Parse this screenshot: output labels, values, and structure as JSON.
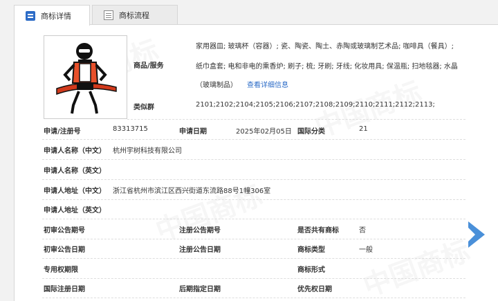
{
  "tabs": [
    {
      "label": "商标详情",
      "active": true,
      "icon": "document-list-icon"
    },
    {
      "label": "商标流程",
      "active": false,
      "icon": "flow-chart-icon"
    }
  ],
  "watermark_text": "中国商标",
  "goods": {
    "label": "商品/服务",
    "lines": [
      "家用器皿; 玻璃杯（容器）; 瓷、陶瓷、陶土、赤陶或玻璃制艺术品; 咖啡具（餐具）;",
      "纸巾盒套; 电和非电的熏香炉; 刷子; 梳; 牙刷; 牙线; 化妆用具; 保温瓶; 扫地毯器; 水晶",
      "（玻璃制品）"
    ],
    "detail_link": "查看详细信息"
  },
  "similar_group": {
    "label": "类似群",
    "value": "2101;2102;2104;2105;2106;2107;2108;2109;2110;2111;2112;2113;"
  },
  "fields": {
    "reg_no_label": "申请/注册号",
    "reg_no": "83313715",
    "app_date_label": "申请日期",
    "app_date": "2025年02月05日",
    "intl_class_label": "国际分类",
    "intl_class": "21",
    "applicant_cn_label": "申请人名称（中文）",
    "applicant_cn": "杭州宇树科技有限公司",
    "applicant_en_label": "申请人名称（英文）",
    "applicant_en": "",
    "address_cn_label": "申请人地址（中文）",
    "address_cn": "浙江省杭州市滨江区西兴街道东流路88号1幢306室",
    "address_en_label": "申请人地址（英文）",
    "address_en": "",
    "prelim_pub_no_label": "初审公告期号",
    "prelim_pub_no": "",
    "reg_pub_no_label": "注册公告期号",
    "reg_pub_no": "",
    "shared_label": "是否共有商标",
    "shared": "否",
    "prelim_pub_date_label": "初审公告日期",
    "prelim_pub_date": "",
    "reg_pub_date_label": "注册公告日期",
    "reg_pub_date": "",
    "mark_type_label": "商标类型",
    "mark_type": "一般",
    "exclusive_period_label": "专用权期限",
    "exclusive_period": "",
    "mark_form_label": "商标形式",
    "mark_form": "",
    "intl_reg_date_label": "国际注册日期",
    "intl_reg_date": "",
    "later_designation_label": "后期指定日期",
    "later_designation": "",
    "priority_date_label": "优先权日期",
    "priority_date": ""
  },
  "colors": {
    "accent": "#2d6cc7",
    "arrow": "#4a90d9",
    "robot_body": "#e8502a"
  }
}
